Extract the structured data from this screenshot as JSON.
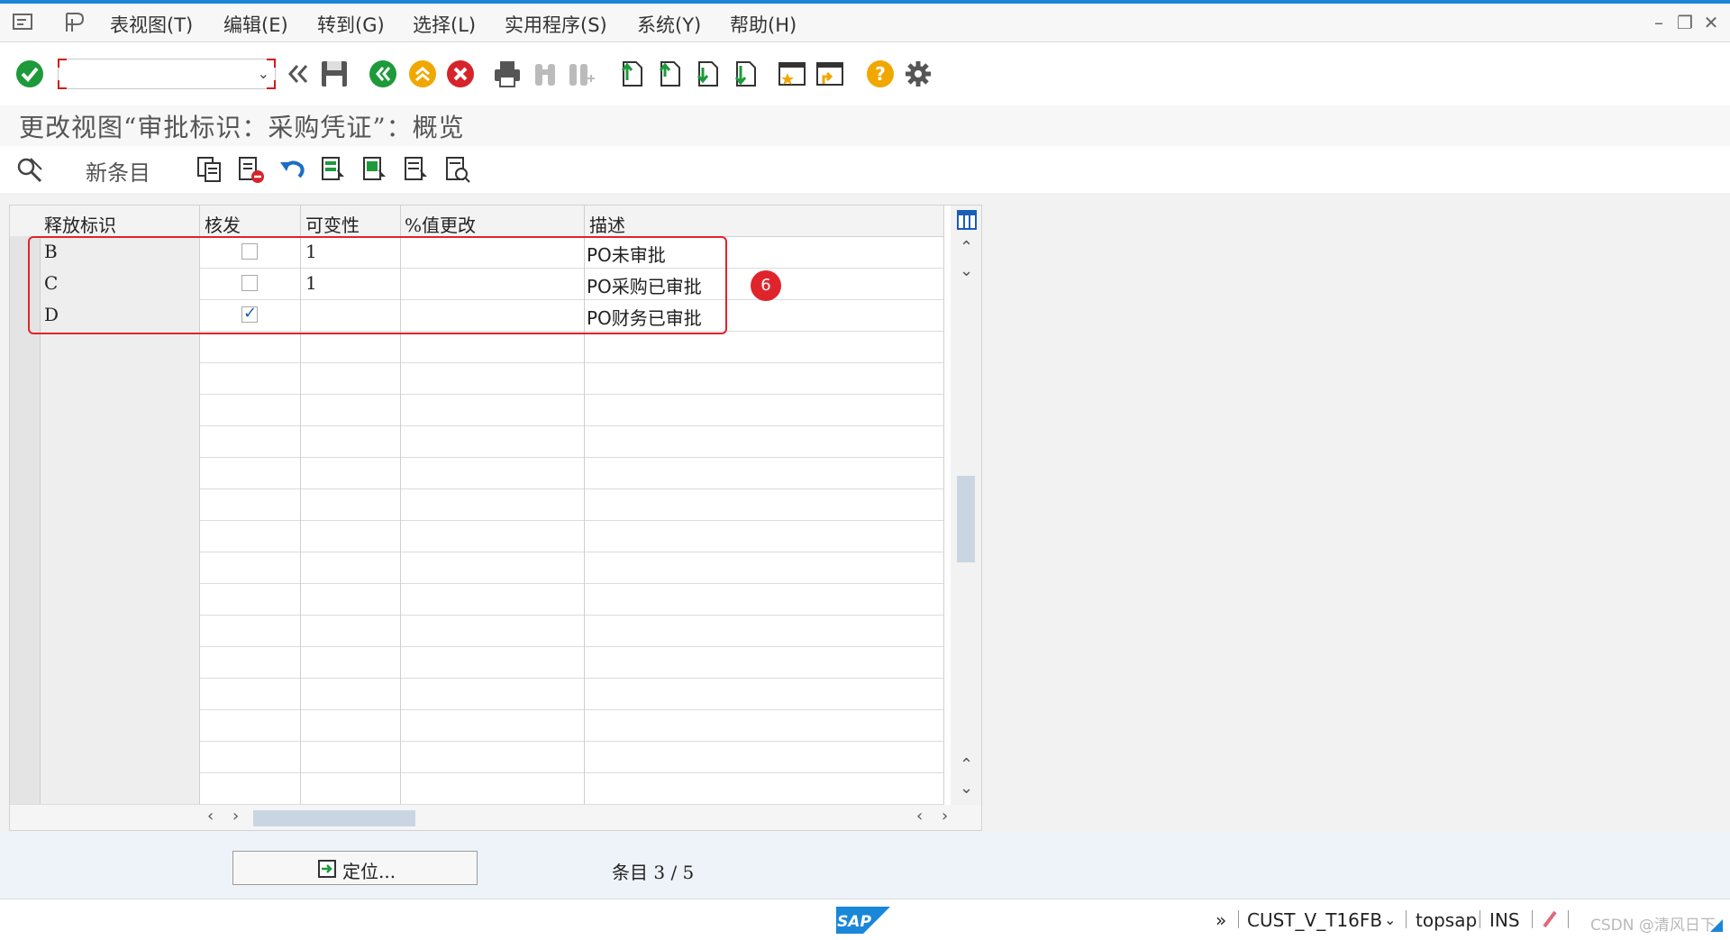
{
  "menu": {
    "items": [
      "表视图(T)",
      "编辑(E)",
      "转到(G)",
      "选择(L)",
      "实用程序(S)",
      "系统(Y)",
      "帮助(H)"
    ]
  },
  "toolbar": {
    "command_field_value": "",
    "icons": [
      "enter-check-icon",
      "command-dropdown",
      "collapse-icon",
      "save-icon",
      "back-icon",
      "exit-icon",
      "cancel-icon",
      "print-icon",
      "find-icon",
      "find-next-icon",
      "first-page-icon",
      "previous-page-icon",
      "next-page-icon",
      "last-page-icon",
      "create-session-icon",
      "shortcut-icon",
      "help-icon",
      "settings-gear-icon"
    ]
  },
  "page": {
    "title": "更改视图“审批标识：采购凭证”：概览"
  },
  "app_toolbar": {
    "new_entry_label": "新条目"
  },
  "table": {
    "columns": [
      "释放标识",
      "核发",
      "可变性",
      "%值更改",
      "描述"
    ],
    "rows": [
      {
        "key": "B",
        "release": false,
        "variability": "1",
        "pct": "",
        "desc": "PO未审批"
      },
      {
        "key": "C",
        "release": false,
        "variability": "1",
        "pct": "",
        "desc": "PO采购已审批"
      },
      {
        "key": "D",
        "release": true,
        "variability": "",
        "pct": "",
        "desc": "PO财务已审批"
      }
    ]
  },
  "annotation": {
    "badge": "6",
    "color": "#e0242c"
  },
  "footer": {
    "position_button": "定位...",
    "entry_label": "条目",
    "entry_count": "3 / 5"
  },
  "status": {
    "expand": "»",
    "transaction": "CUST_V_T16FB",
    "server": "topsap",
    "mode": "INS",
    "sap_logo": "SAP",
    "watermark": "CSDN @清风日下"
  },
  "colors": {
    "accent": "#1a87d8",
    "ok_green": "#1d9a3a",
    "exit_orange": "#f0a800",
    "cancel_red": "#d7232a"
  }
}
